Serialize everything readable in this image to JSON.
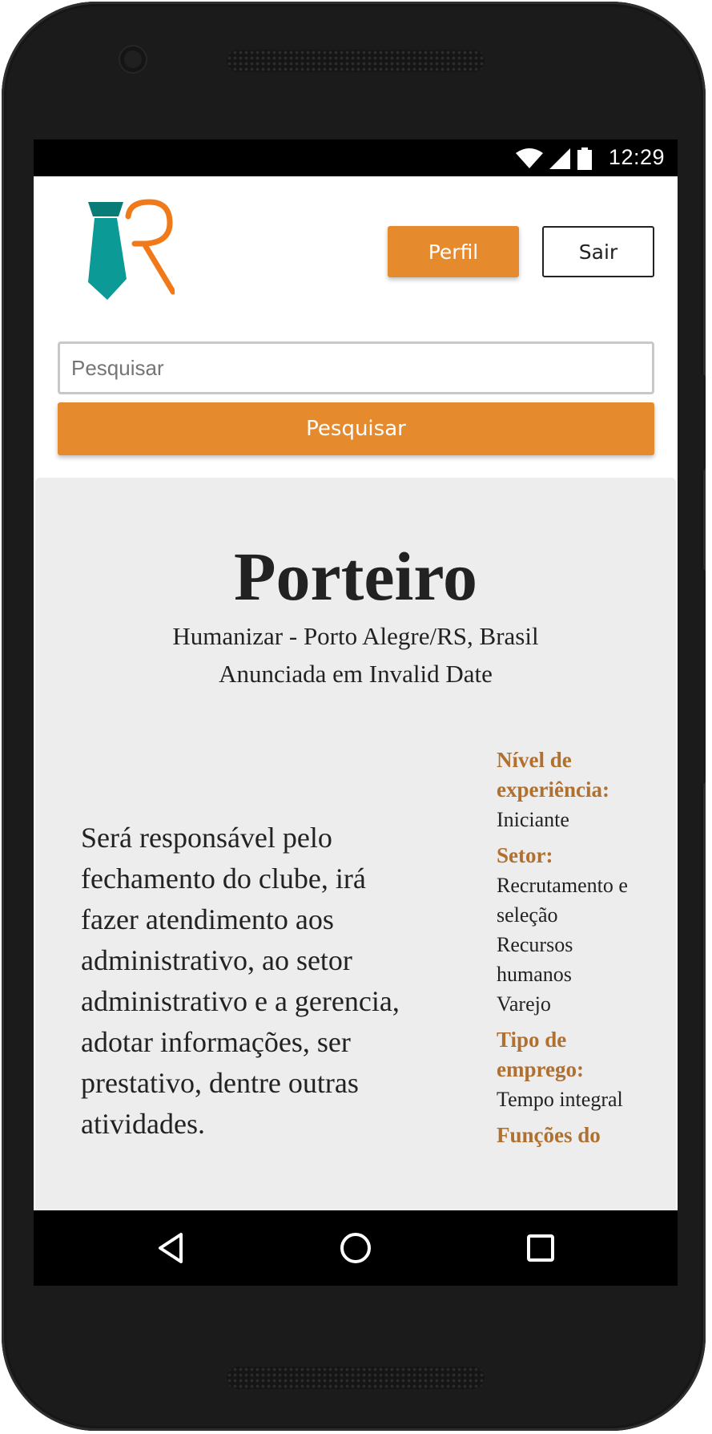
{
  "status_bar": {
    "time": "12:29",
    "icons": [
      "wifi-icon",
      "signal-icon",
      "battery-icon"
    ]
  },
  "header": {
    "logo": "tie-r-logo",
    "profile_button": "Perfil",
    "logout_button": "Sair"
  },
  "search": {
    "placeholder": "Pesquisar",
    "value": "",
    "button": "Pesquisar"
  },
  "job": {
    "title": "Porteiro",
    "company_location": "Humanizar - Porto Alegre/RS, Brasil",
    "posted": "Anunciada em Invalid Date",
    "description": "Será responsável pelo fechamento do clube, irá fazer atendimento aos administrativo, ao setor administrativo e a gerencia, adotar informações, ser prestativo, dentre outras atividades.",
    "details": [
      {
        "label": "Nível de experiência:",
        "values": [
          "Iniciante"
        ]
      },
      {
        "label": "Setor:",
        "values": [
          "Recrutamento e seleção",
          "Recursos humanos",
          "Varejo"
        ]
      },
      {
        "label": "Tipo de emprego:",
        "values": [
          "Tempo integral"
        ]
      },
      {
        "label": "Funções do",
        "values": []
      }
    ]
  },
  "nav_bar": {
    "icons": [
      "back-icon",
      "home-icon",
      "recents-icon"
    ]
  },
  "colors": {
    "accent": "#e68a2e",
    "label": "#b07030",
    "card_bg": "#ededed",
    "logo_teal": "#0c9a96",
    "logo_orange": "#f07a1a"
  }
}
